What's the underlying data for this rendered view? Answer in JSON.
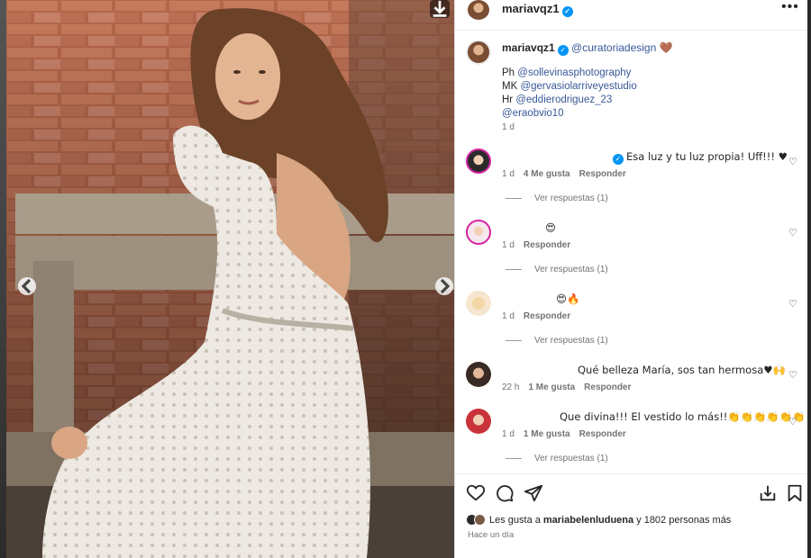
{
  "post": {
    "username": "mariavqz1",
    "caption": {
      "username": "mariavqz1",
      "tag": "@curatoriadesign",
      "emoji": "🤎",
      "lines": [
        {
          "prefix": "Ph",
          "mention": "@sollevinasphotography"
        },
        {
          "prefix": "MK",
          "mention": "@gervasiolarriveyestudio"
        },
        {
          "prefix": "Hr",
          "mention": "@eddierodriguez_23"
        },
        {
          "prefix": "",
          "mention": "@eraobvio10"
        }
      ],
      "time": "1 d"
    },
    "comments": [
      {
        "text": "Esa luz y tu luz propia! Uff!!! ♥",
        "time": "1 d",
        "likes": "4 Me gusta",
        "reply": "Responder",
        "replies": "Ver respuestas (1)"
      },
      {
        "text": "😍",
        "time": "1 d",
        "likes": "",
        "reply": "Responder",
        "replies": "Ver respuestas (1)"
      },
      {
        "text": "😍🔥",
        "time": "1 d",
        "likes": "",
        "reply": "Responder",
        "replies": "Ver respuestas (1)"
      },
      {
        "text": "Qué belleza María, sos tan hermosa♥🙌",
        "time": "22 h",
        "likes": "1 Me gusta",
        "reply": "Responder",
        "replies": ""
      },
      {
        "text": "Que divina!!! El vestido lo más!!👏👏👏👏👏👏",
        "time": "1 d",
        "likes": "1 Me gusta",
        "reply": "Responder",
        "replies": "Ver respuestas (1)"
      }
    ],
    "likes_prefix": "Les gusta a",
    "likes_user": "mariabelenluduena",
    "likes_suffix": "y 1802 personas más",
    "posted": "Hace un día"
  },
  "icons": [
    "download-icon",
    "chevron-left-icon",
    "chevron-right-icon",
    "more-icon",
    "heart-icon",
    "comment-icon",
    "share-icon",
    "save-collection-icon",
    "bookmark-icon"
  ],
  "colors": {
    "verified": "#0095f6",
    "mention": "#385898",
    "muted": "#737373"
  }
}
